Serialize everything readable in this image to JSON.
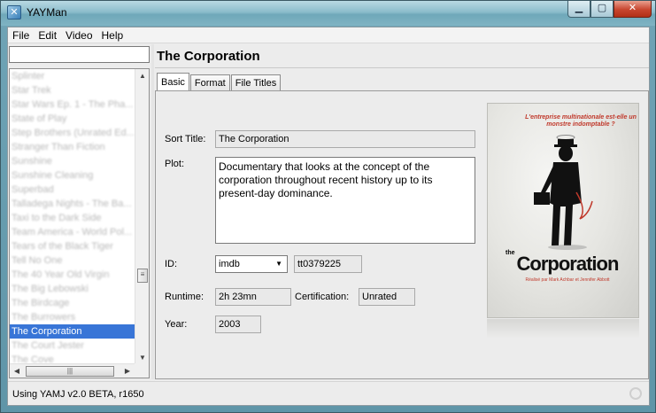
{
  "window": {
    "title": "YAYMan"
  },
  "menubar": {
    "items": [
      "File",
      "Edit",
      "Video",
      "Help"
    ]
  },
  "search": {
    "value": "",
    "placeholder": ""
  },
  "movie_list": {
    "items": [
      "Splinter",
      "Star Trek",
      "Star Wars Ep. 1 - The Pha...",
      "State of Play",
      "Step Brothers (Unrated Ed...",
      "Stranger Than Fiction",
      "Sunshine",
      "Sunshine Cleaning",
      "Superbad",
      "Talladega Nights - The Ba...",
      "Taxi to the Dark Side",
      "Team America - World Pol...",
      "Tears of the Black Tiger",
      "Tell No One",
      "The 40 Year Old Virgin",
      "The Big Lebowski",
      "The Birdcage",
      "The Burrowers",
      "The Corporation",
      "The Court Jester",
      "The Cove"
    ],
    "selected_index": 18
  },
  "detail": {
    "title": "The Corporation",
    "tabs": [
      "Basic",
      "Format",
      "File Titles"
    ],
    "active_tab": "Basic",
    "sort_title_label": "Sort Title:",
    "sort_title": "The Corporation",
    "plot_label": "Plot:",
    "plot": "Documentary that looks at the concept of the corporation throughout recent history up to its present-day dominance.",
    "id_label": "ID:",
    "id_source": "imdb",
    "id_value": "tt0379225",
    "runtime_label": "Runtime:",
    "runtime": "2h 23mn",
    "certification_label": "Certification:",
    "certification": "Unrated",
    "year_label": "Year:",
    "year": "2003"
  },
  "poster": {
    "tagline": "L'entreprise multinationale est-elle un monstre indomptable ?",
    "title_small": "the",
    "title": "Corporation",
    "credits": "Réalisé par Mark Achbar et Jennifer Abbott"
  },
  "status": {
    "text": "Using YAMJ v2.0 BETA, r1650"
  },
  "icons": {
    "app": "yayman-icon",
    "minimize": "minimize-icon",
    "maximize": "maximize-icon",
    "close": "close-icon"
  }
}
